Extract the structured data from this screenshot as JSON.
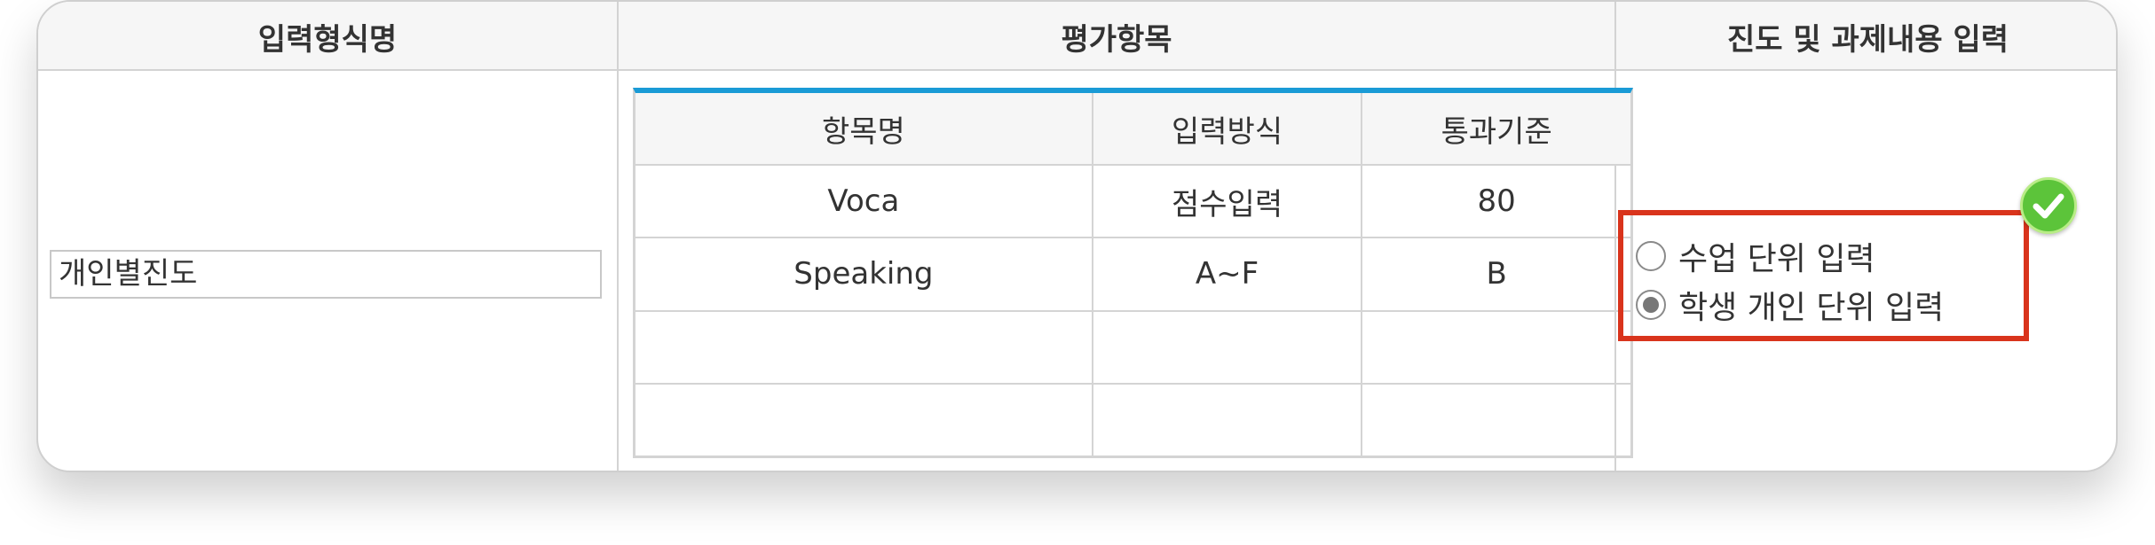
{
  "headers": {
    "col1": "입력형식명",
    "col2": "평가항목",
    "col3": "진도 및 과제내용 입력"
  },
  "format_name": {
    "value": "개인별진도"
  },
  "eval_table": {
    "columns": [
      "항목명",
      "입력방식",
      "통과기준"
    ],
    "rows": [
      [
        "Voca",
        "점수입력",
        "80"
      ],
      [
        "Speaking",
        "A~F",
        "B"
      ],
      [
        "",
        "",
        ""
      ],
      [
        "",
        "",
        ""
      ]
    ]
  },
  "input_options": {
    "options": [
      "수업 단위 입력",
      "학생 개인 단위 입력"
    ],
    "selected": "학생 개인 단위 입력"
  },
  "colors": {
    "accent_blue": "#1a9bd6",
    "highlight_red": "#d9341c",
    "check_green": "#5cc43a"
  },
  "icons": {
    "check_badge": "check-circle-icon"
  }
}
